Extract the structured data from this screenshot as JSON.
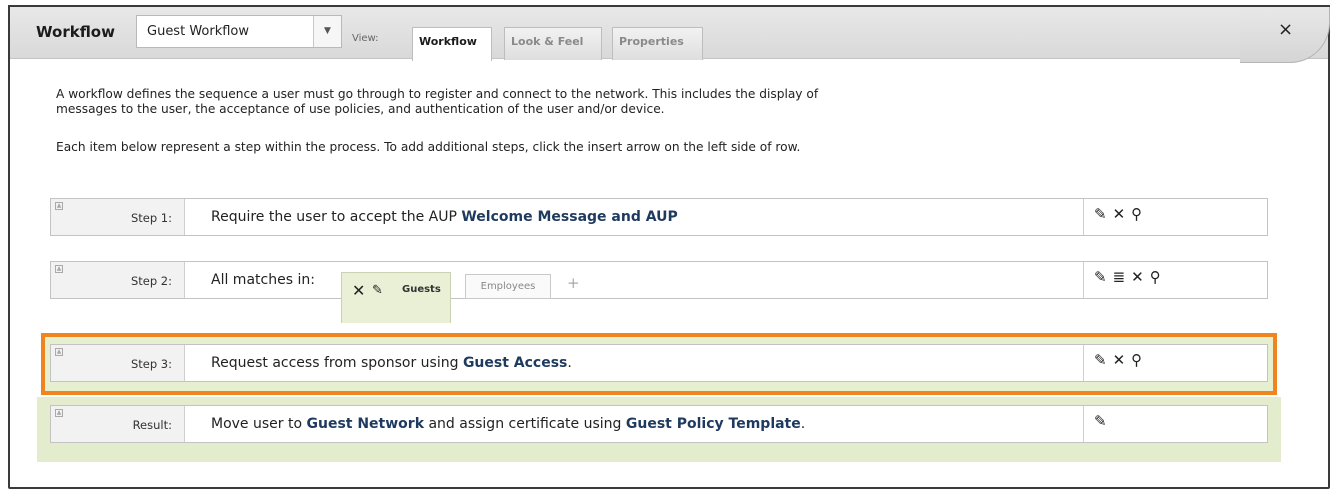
{
  "header": {
    "title": "Workflow",
    "select_value": "Guest Workflow",
    "view_label": "View:",
    "tabs": [
      "Workflow",
      "Look & Feel",
      "Properties"
    ],
    "close": "×"
  },
  "description": {
    "line1": "A workflow defines the sequence a user must go through to register and connect to the network. This includes the display of",
    "line2": "messages to the user, the acceptance of use policies, and authentication of the user and/or device.",
    "line3": "Each item below represent a step within the process. To add additional steps, click the insert arrow on the left side of row."
  },
  "steps": [
    {
      "label": "Step 1:",
      "text": "Require the user to accept the AUP ",
      "bold": "Welcome Message and AUP",
      "actions": [
        "edit-icon",
        "delete-icon",
        "search-icon"
      ]
    },
    {
      "label": "Step 2:",
      "text": "All matches in:",
      "chips": {
        "guests": "Guests",
        "employees": "Employees",
        "add": "+"
      },
      "actions": [
        "edit-icon",
        "list-icon",
        "delete-icon",
        "search-icon"
      ]
    },
    {
      "label": "Step 3:",
      "text": "Request access from sponsor using ",
      "bold": "Guest Access",
      "suffix": ".",
      "actions": [
        "edit-icon",
        "delete-icon",
        "search-icon"
      ]
    },
    {
      "label": "Result:",
      "text1": "Move user to ",
      "bold1": "Guest Network",
      "text2": " and assign certificate using ",
      "bold2": "Guest Policy Template",
      "suffix": ".",
      "actions": [
        "edit-icon"
      ]
    }
  ],
  "colors": {
    "highlight_border": "#f0851f",
    "result_bg": "#e3edcd",
    "bold_text": "#1f3a5f"
  }
}
